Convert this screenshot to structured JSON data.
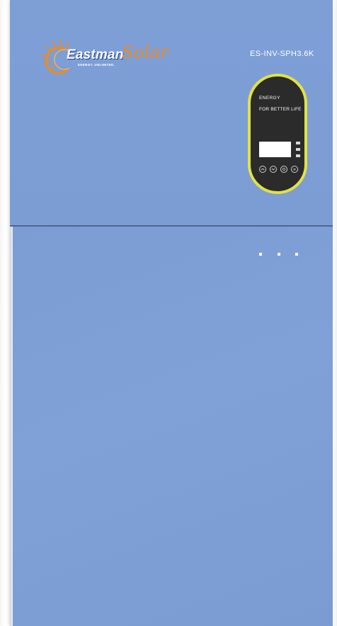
{
  "brand": {
    "name": "Eastman",
    "name_suffix": "Solar",
    "tagline": "ENERGY. UNLIMITED."
  },
  "model": "ES-INV-SPH3.6K",
  "panel": {
    "line1": "ENERGY",
    "line2": "FOR BETTER LIFE"
  },
  "colors": {
    "body": "#7c9dd4",
    "panel_border": "#e2e244",
    "panel_bg": "#2b2b2b",
    "brand_orange": "#f08a1c"
  },
  "icons": [
    "sun-logo-icon",
    "up-arrow-icon",
    "down-arrow-icon",
    "enter-icon",
    "back-icon"
  ]
}
